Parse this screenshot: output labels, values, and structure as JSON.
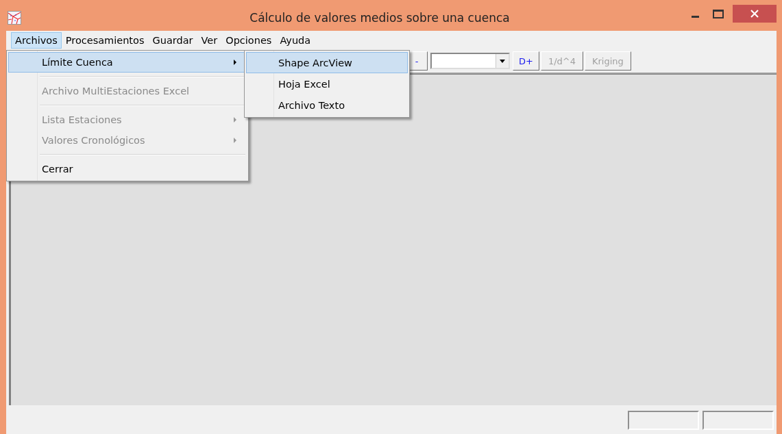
{
  "window": {
    "title": "Cálculo de valores medios sobre una cuenca"
  },
  "menu_bar": [
    {
      "label": "Archivos",
      "selected": true
    },
    {
      "label": "Procesamientos",
      "selected": false
    },
    {
      "label": "Guardar",
      "selected": false
    },
    {
      "label": "Ver",
      "selected": false
    },
    {
      "label": "Opciones",
      "selected": false
    },
    {
      "label": "Ayuda",
      "selected": false
    }
  ],
  "dropdown": [
    {
      "kind": "item",
      "label": "Límite Cuenca",
      "disabled": false,
      "submenu": true,
      "selected": true
    },
    {
      "kind": "separator"
    },
    {
      "kind": "item",
      "label": "Archivo MultiEstaciones Excel",
      "disabled": true,
      "submenu": false,
      "selected": false
    },
    {
      "kind": "separator"
    },
    {
      "kind": "item",
      "label": "Lista Estaciones",
      "disabled": true,
      "submenu": true,
      "selected": false
    },
    {
      "kind": "item",
      "label": "Valores Cronológicos",
      "disabled": true,
      "submenu": true,
      "selected": false
    },
    {
      "kind": "separator"
    },
    {
      "kind": "item",
      "label": "Cerrar",
      "disabled": false,
      "submenu": false,
      "selected": false
    }
  ],
  "submenu": [
    {
      "label": "Shape ArcView",
      "selected": true
    },
    {
      "label": "Hoja Excel",
      "selected": false
    },
    {
      "label": "Archivo Texto",
      "selected": false
    }
  ],
  "toolbar": [
    {
      "kind": "button",
      "label": "-",
      "disabled": false
    },
    {
      "kind": "combo"
    },
    {
      "kind": "button",
      "label": "D+",
      "disabled": false
    },
    {
      "kind": "button",
      "label": "1/d^4",
      "disabled": true
    },
    {
      "kind": "button",
      "label": "Kriging",
      "disabled": true
    }
  ]
}
